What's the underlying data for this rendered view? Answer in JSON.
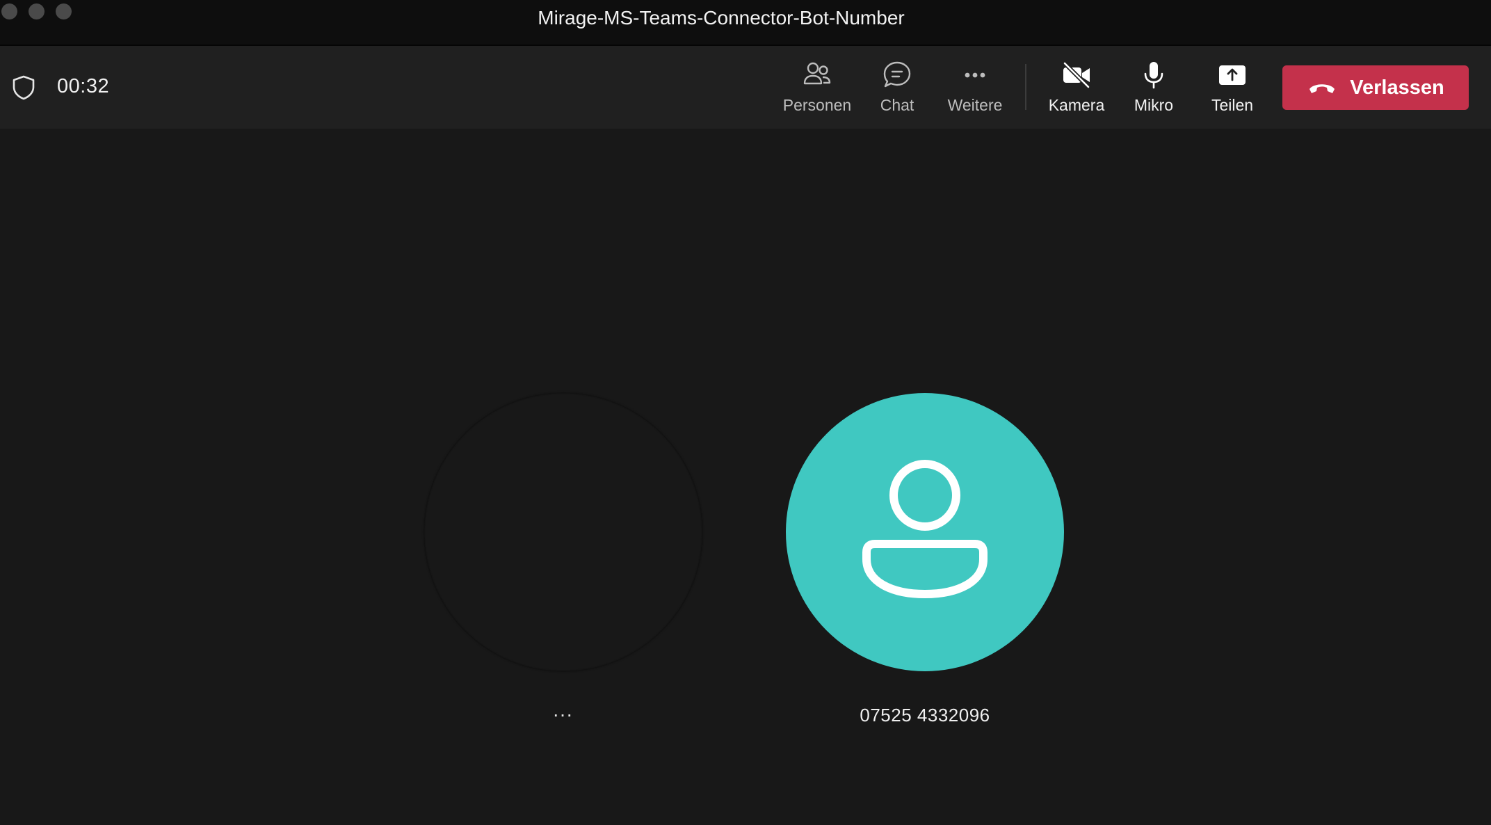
{
  "window": {
    "title": "Mirage-MS-Teams-Connector-Bot-Number"
  },
  "toolbar": {
    "timer": "00:32",
    "buttons": {
      "people": {
        "label": "Personen",
        "icon": "people-icon"
      },
      "chat": {
        "label": "Chat",
        "icon": "chat-icon"
      },
      "more": {
        "label": "Weitere",
        "icon": "more-icon"
      },
      "camera": {
        "label": "Kamera",
        "icon": "camera-off-icon"
      },
      "mic": {
        "label": "Mikro",
        "icon": "microphone-icon"
      },
      "share": {
        "label": "Teilen",
        "icon": "share-icon"
      }
    },
    "leave": {
      "label": "Verlassen",
      "icon": "hangup-icon",
      "color": "#c4314b"
    }
  },
  "stage": {
    "participants": [
      {
        "label": "..."
      },
      {
        "label": "07525 4332096",
        "avatar_color": "#40c8c1",
        "icon": "person-icon"
      }
    ]
  }
}
